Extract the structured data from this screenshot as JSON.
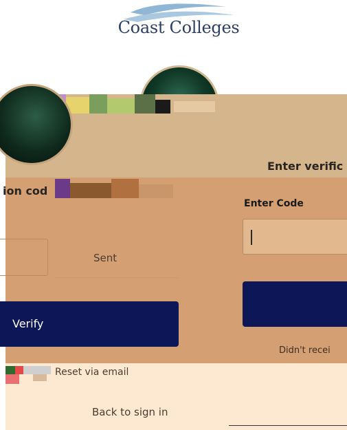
{
  "brand": {
    "logo_text": "Coast Colleges"
  },
  "panel_right": {
    "heading": "Enter verific",
    "code_label": "Enter Code",
    "code_value": "",
    "verify_label": "",
    "didnt_receive": "Didn't recei"
  },
  "panel_left": {
    "heading": "ion cod",
    "sent_label": "Sent",
    "verify_label": "Verify"
  },
  "footer": {
    "reset_link": "Reset via email",
    "back_link": "Back to sign in"
  },
  "colors": {
    "card": "#d49f73",
    "banner": "#d5b58c",
    "button": "#0d1657",
    "footer": "#fde9d1"
  },
  "icons": {
    "avatar": "avatar-icon",
    "caret": "text-caret"
  }
}
